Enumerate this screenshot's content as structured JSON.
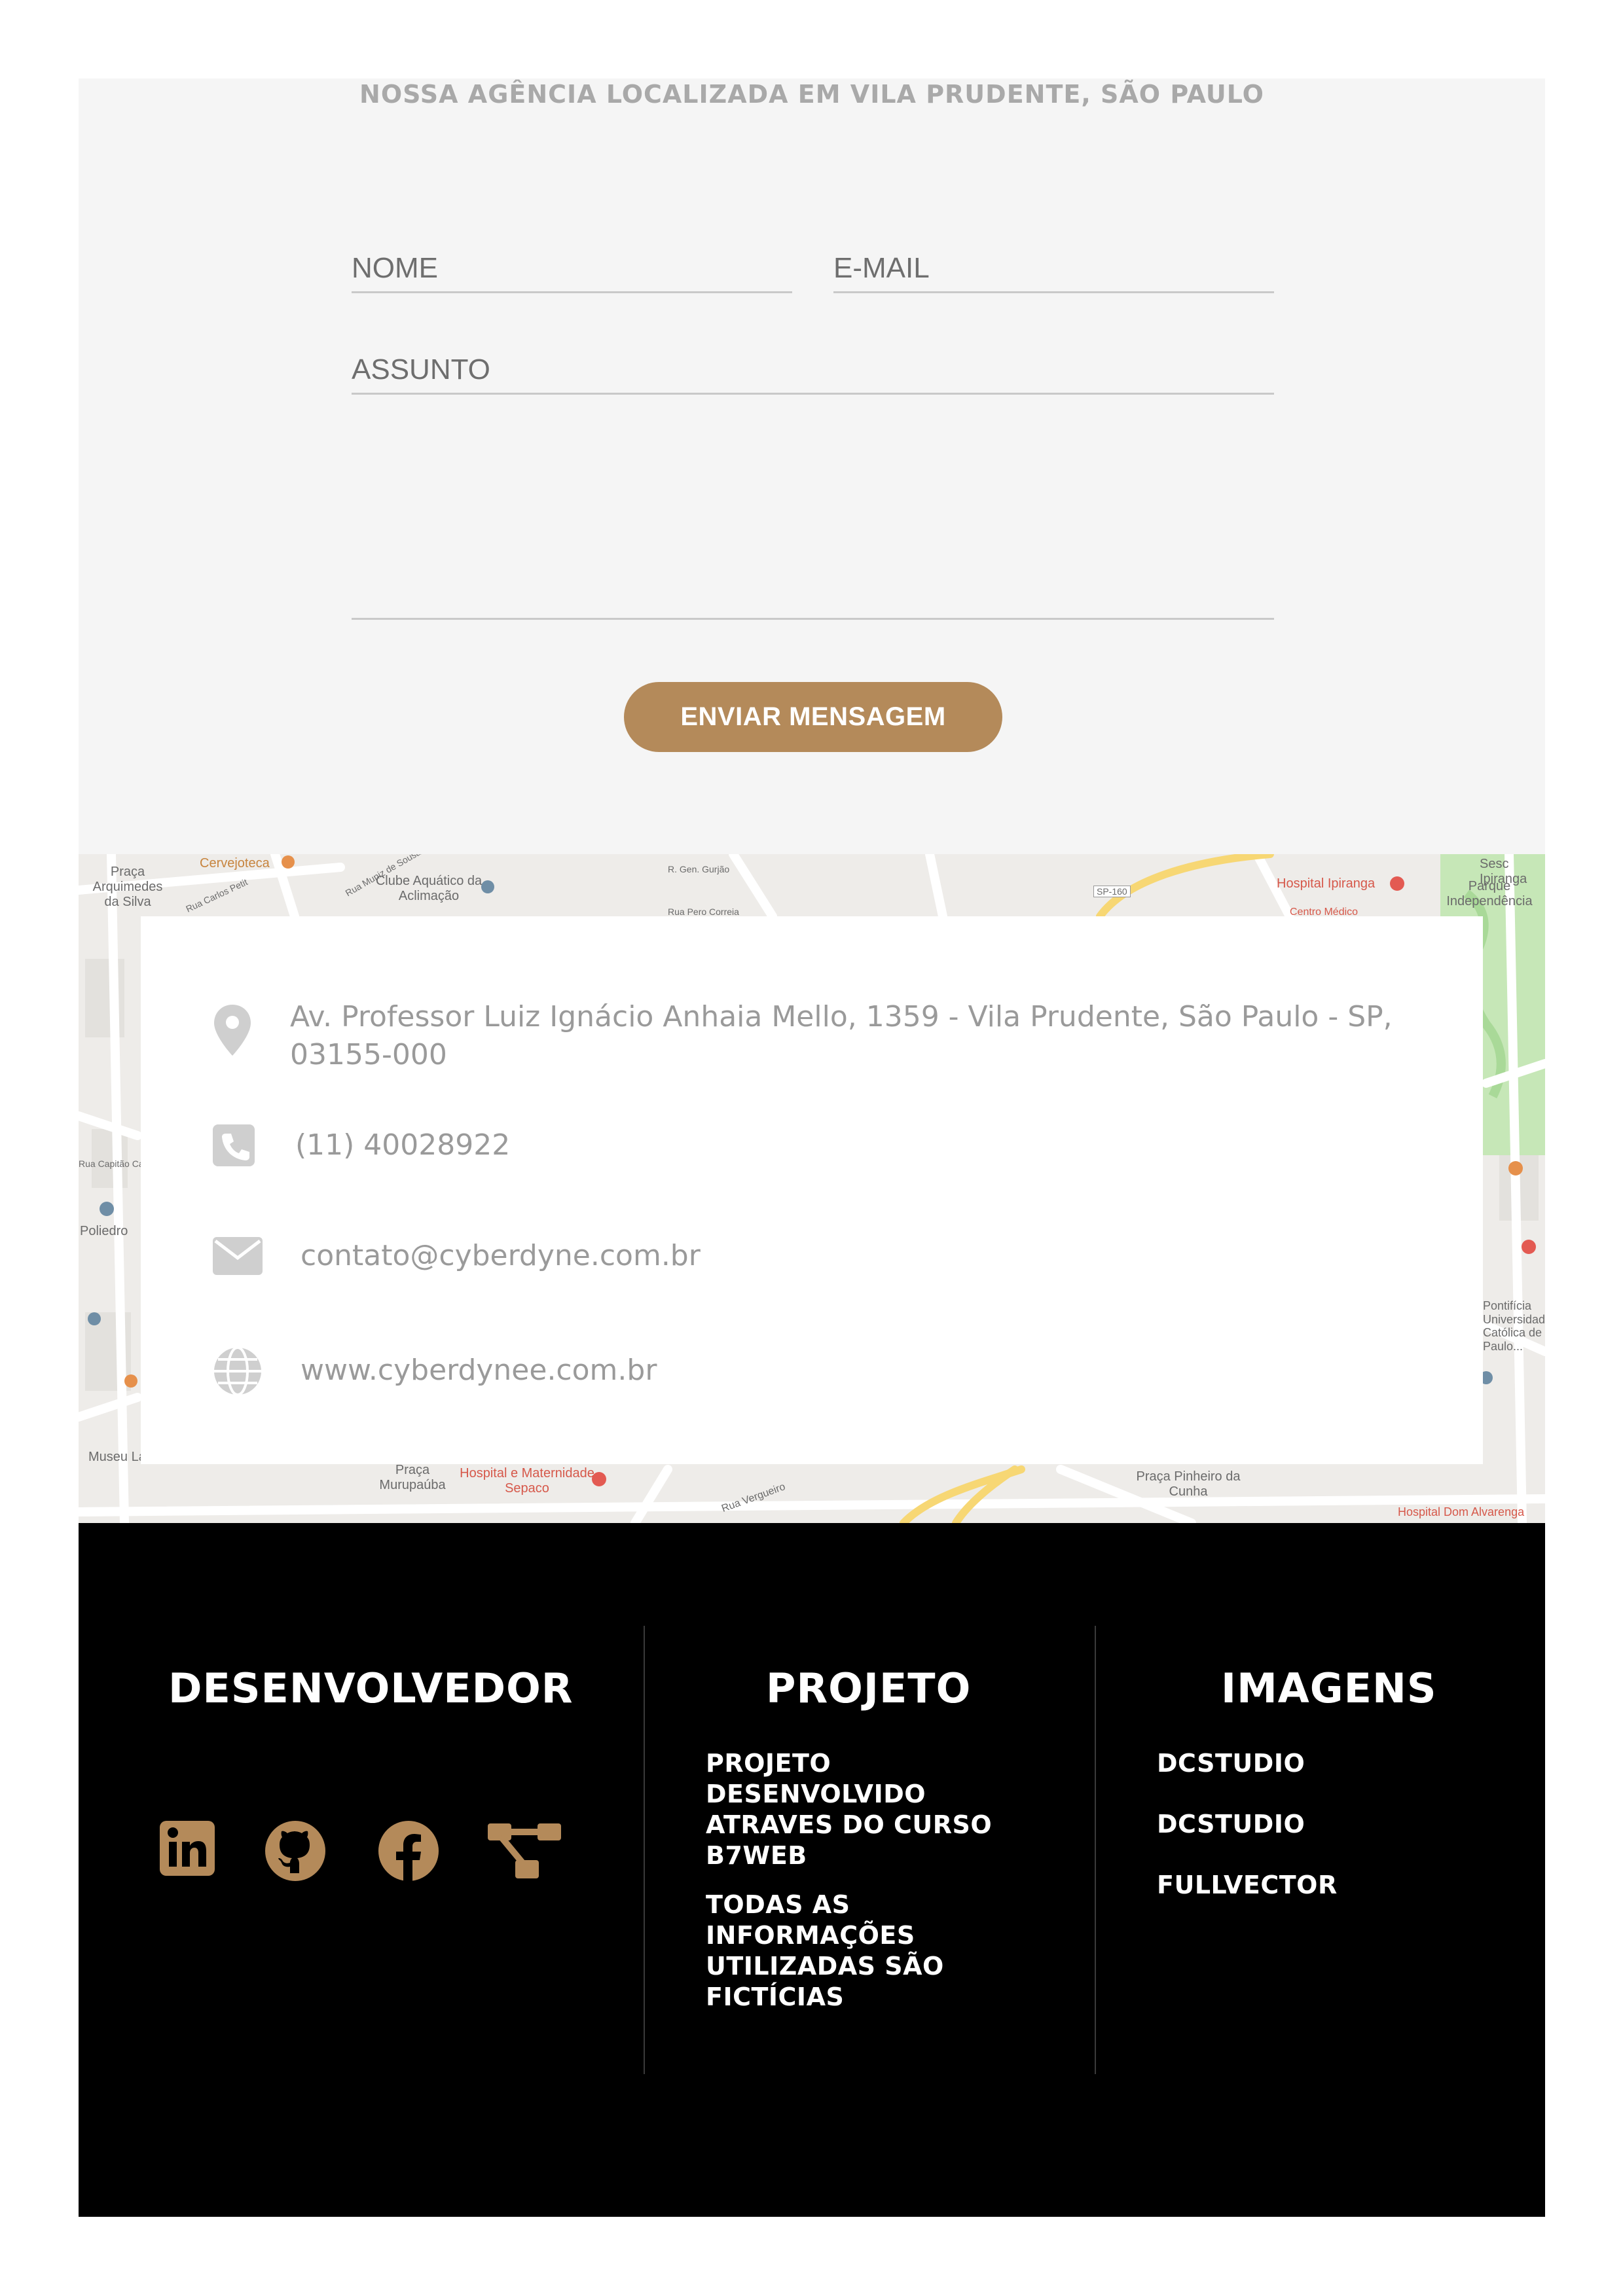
{
  "contact": {
    "subtitle": "NOSSA AGÊNCIA LOCALIZADA EM VILA PRUDENTE, SÃO PAULO",
    "form": {
      "name_placeholder": "NOME",
      "email_placeholder": "E-MAIL",
      "subject_placeholder": "ASSUNTO",
      "message_placeholder": "",
      "submit_label": "ENVIAR MENSAGEM"
    }
  },
  "map": {
    "labels": [
      "Cervejoteca",
      "Praça Arquimedes da Silva",
      "Rua Carlos Petit",
      "Clube Aquático da Aclimação",
      "Rua Muniz de Sousa",
      "R. Gen. Gurjão",
      "Rua Pero Correia",
      "SP-160",
      "Hospital Ipiranga",
      "Sesc Ipiranga",
      "Parque Independência",
      "Centro Médico",
      "Rua Capitão Cavalcanti",
      "Poliedro",
      "Museu Lasar Segall",
      "Praça Murupaúba",
      "Hospital e Maternidade Sepaco",
      "Rua Vergueiro",
      "Praça Pinheiro da Cunha",
      "Hospital Dom Alvarenga",
      "Pontifícia Universidade Católica de Paulo..."
    ],
    "contact_info": {
      "address": "Av. Professor Luiz Ignácio Anhaia Mello, 1359 - Vila Prudente, São Paulo - SP, 03155-000",
      "phone": "(11) 40028922",
      "email": "contato@cyberdyne.com.br",
      "website": "www.cyberdynee.com.br"
    },
    "icons": [
      "map-pin-icon",
      "phone-icon",
      "envelope-icon",
      "globe-icon"
    ]
  },
  "footer": {
    "developer": {
      "title": "DESENVOLVEDOR",
      "social_icons": [
        "linkedin-icon",
        "github-icon",
        "facebook-icon",
        "sitemap-icon"
      ]
    },
    "project": {
      "title": "PROJETO",
      "lines": [
        "PROJETO DESENVOLVIDO ATRAVES DO CURSO B7WEB",
        "TODAS AS INFORMAÇÕES UTILIZADAS SÃO FICTÍCIAS"
      ]
    },
    "images": {
      "title": "IMAGENS",
      "credits": [
        "DCSTUDIO",
        "DCSTUDIO",
        "FULLVECTOR"
      ]
    }
  },
  "colors": {
    "accent": "#b48a5a",
    "section_bg": "#f5f5f5",
    "footer_bg": "#000000",
    "muted_text": "#9a9a9a"
  }
}
